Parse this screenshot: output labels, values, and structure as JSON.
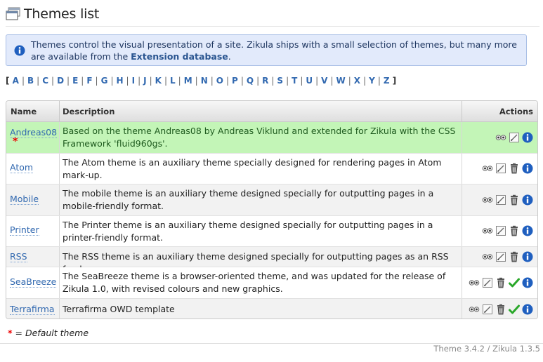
{
  "page": {
    "title": "Themes list",
    "icon": "themes-window-icon"
  },
  "info": {
    "text_before": "Themes control the visual presentation of a site. Zikula ships with a small selection of themes, but many more are available from the ",
    "link": "Extension database",
    "text_after": "."
  },
  "alphabet": {
    "open": "[",
    "close": "]",
    "letters": [
      "A",
      "B",
      "C",
      "D",
      "E",
      "F",
      "G",
      "H",
      "I",
      "J",
      "K",
      "L",
      "M",
      "N",
      "O",
      "P",
      "Q",
      "R",
      "S",
      "T",
      "U",
      "V",
      "W",
      "X",
      "Y",
      "Z"
    ]
  },
  "table": {
    "headers": {
      "name": "Name",
      "description": "Description",
      "actions": "Actions"
    },
    "rows": [
      {
        "name": "Andreas08",
        "description": "Based on the theme Andreas08 by Andreas Viklund and extended for Zikula with the CSS Framework 'fluid960gs'.",
        "is_default": true,
        "default_marker": "*",
        "actions": [
          "preview-icon",
          "edit-icon",
          "info-icon"
        ]
      },
      {
        "name": "Atom",
        "description": "The Atom theme is an auxiliary theme specially designed for rendering pages in Atom mark-up.",
        "actions": [
          "preview-icon",
          "edit-icon",
          "delete-icon",
          "info-icon"
        ]
      },
      {
        "name": "Mobile",
        "description": "The mobile theme is an auxiliary theme designed specially for outputting pages in a mobile-friendly format.",
        "actions": [
          "preview-icon",
          "edit-icon",
          "delete-icon",
          "info-icon"
        ]
      },
      {
        "name": "Printer",
        "description": "The Printer theme is an auxiliary theme designed specially for outputting pages in a printer-friendly format.",
        "actions": [
          "preview-icon",
          "edit-icon",
          "delete-icon",
          "info-icon"
        ]
      },
      {
        "name": "RSS",
        "description": "The RSS theme is an auxiliary theme designed specially for outputting pages as an RSS feed.",
        "actions": [
          "preview-icon",
          "edit-icon",
          "delete-icon",
          "info-icon"
        ]
      },
      {
        "name": "SeaBreeze",
        "description": "The SeaBreeze theme is a browser-oriented theme, and was updated for the release of Zikula 1.0, with revised colours and new graphics.",
        "actions": [
          "preview-icon",
          "edit-icon",
          "delete-icon",
          "set-default-check-icon",
          "info-icon"
        ]
      },
      {
        "name": "Terrafirma",
        "description": "Terrafirma OWD template",
        "actions": [
          "preview-icon",
          "edit-icon",
          "delete-icon",
          "set-default-check-icon",
          "info-icon"
        ]
      }
    ]
  },
  "legend": {
    "star": "*",
    "text": "= Default theme"
  },
  "footer": {
    "version": "Theme 3.4.2 / Zikula 1.3.5"
  },
  "colors": {
    "link": "#3269b0",
    "default_row": "#c3f5b7",
    "info_bg": "#e2eafb",
    "info_icon": "#1f5fbf",
    "check": "#2aa82a"
  }
}
